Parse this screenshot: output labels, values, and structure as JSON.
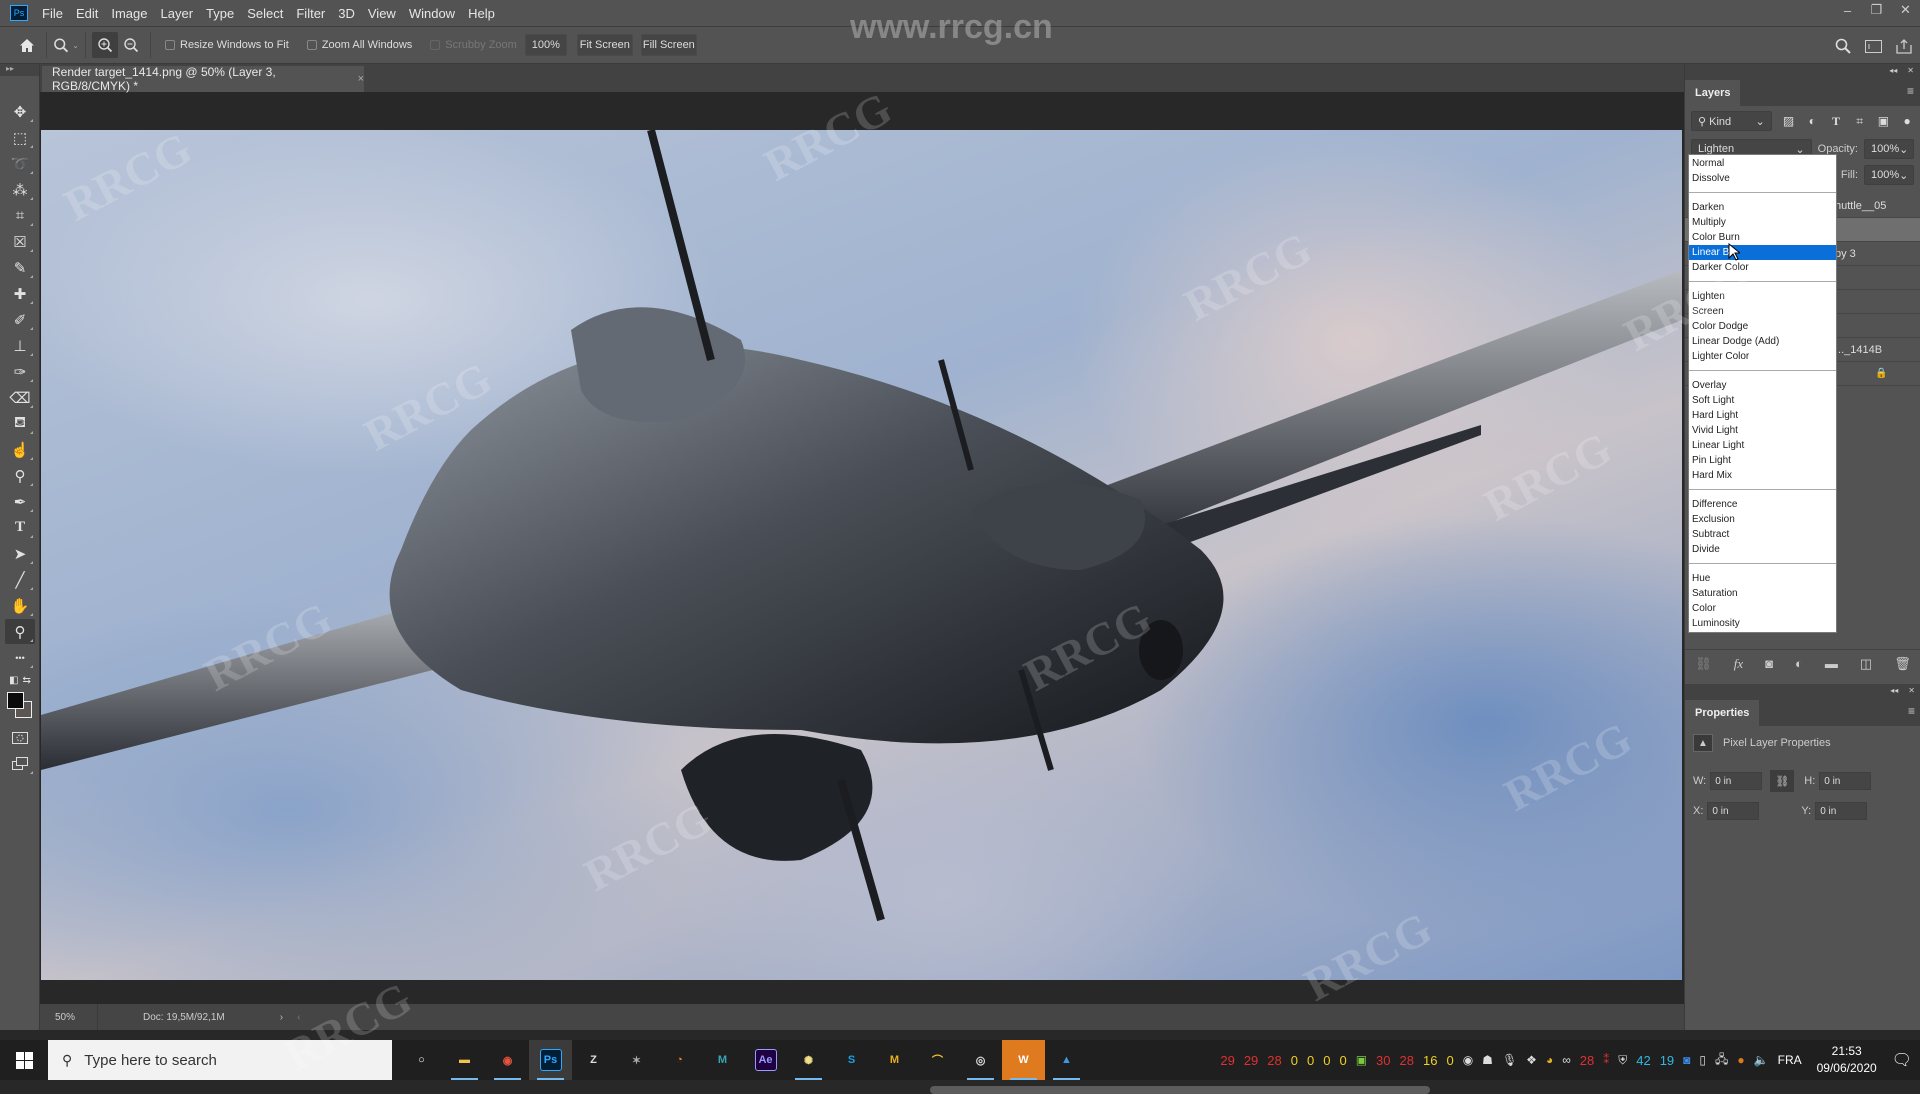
{
  "app": {
    "logo": "Ps",
    "watermark_site": "www.rrcg.cn",
    "watermark_text": "RRCG"
  },
  "menu": [
    "File",
    "Edit",
    "Image",
    "Layer",
    "Type",
    "Select",
    "Filter",
    "3D",
    "View",
    "Window",
    "Help"
  ],
  "window_controls": {
    "minimize": "–",
    "restore": "❐",
    "close": "✕"
  },
  "options_bar": {
    "resize_windows_label": "Resize Windows to Fit",
    "resize_windows_checked": false,
    "zoom_all_label": "Zoom All Windows",
    "zoom_all_checked": false,
    "scrubby_zoom_label": "Scrubby Zoom",
    "scrubby_zoom_checked": false,
    "zoom_value": "100%",
    "fit_screen_label": "Fit Screen",
    "fill_screen_label": "Fill Screen"
  },
  "tools": [
    "move",
    "rectangular-marquee",
    "lasso",
    "magic-wand",
    "crop",
    "frame",
    "eyedropper",
    "healing-brush",
    "brush",
    "clone-stamp",
    "history-brush",
    "eraser",
    "paint-bucket",
    "smudge",
    "dodge",
    "pen",
    "type",
    "path-selection",
    "line",
    "hand",
    "zoom",
    "more-tools"
  ],
  "document": {
    "tab_title": "Render target_1414.png @ 50% (Layer 3, RGB/8/CMYK) *",
    "close_label": "×",
    "status_zoom": "50%",
    "status_doc": "Doc: 19,5M/92,1M"
  },
  "layers_panel": {
    "title": "Layers",
    "filter_kind": "Kind",
    "blend_mode": "Lighten",
    "opacity_label": "Opacity:",
    "opacity_value": "100%",
    "fill_label": "Fill:",
    "fill_value": "100%",
    "layers": [
      {
        "name": "huttle__05",
        "selected": false
      },
      {
        "name": "",
        "selected": true
      },
      {
        "name": "py 3",
        "selected": false
      },
      {
        "name": "",
        "selected": false
      },
      {
        "name": "",
        "selected": false
      },
      {
        "name": "",
        "selected": false
      },
      {
        "name": "..._1414B",
        "selected": false
      },
      {
        "name": "",
        "selected": false,
        "locked": true
      }
    ]
  },
  "blend_dropdown": {
    "highlighted": "Linear Burn",
    "highlighted_visible_text": "Linear Bu",
    "groups": [
      [
        "Normal",
        "Dissolve"
      ],
      [
        "Darken",
        "Multiply",
        "Color Burn",
        "Linear Burn",
        "Darker Color"
      ],
      [
        "Lighten",
        "Screen",
        "Color Dodge",
        "Linear Dodge (Add)",
        "Lighter Color"
      ],
      [
        "Overlay",
        "Soft Light",
        "Hard Light",
        "Vivid Light",
        "Linear Light",
        "Pin Light",
        "Hard Mix"
      ],
      [
        "Difference",
        "Exclusion",
        "Subtract",
        "Divide"
      ],
      [
        "Hue",
        "Saturation",
        "Color",
        "Luminosity"
      ]
    ]
  },
  "properties_panel": {
    "title": "Properties",
    "subtitle": "Pixel Layer Properties",
    "w_label": "W:",
    "w_value": "0 in",
    "h_label": "H:",
    "h_value": "0 in",
    "x_label": "X:",
    "x_value": "0 in",
    "y_label": "Y:",
    "y_value": "0 in"
  },
  "taskbar": {
    "search_placeholder": "Type here to search",
    "apps": [
      {
        "name": "cortana",
        "glyph": "○",
        "color": "#ffffff",
        "running": false
      },
      {
        "name": "file-explorer",
        "glyph": "▬",
        "color": "#f2c14e",
        "running": true
      },
      {
        "name": "chrome",
        "glyph": "◉",
        "color": "#e5533d",
        "running": true
      },
      {
        "name": "photoshop",
        "glyph": "Ps",
        "color": "#31a8ff",
        "running": true,
        "active": true
      },
      {
        "name": "zbrush",
        "glyph": "Z",
        "color": "#dddddd",
        "running": false
      },
      {
        "name": "substance",
        "glyph": "✶",
        "color": "#aaaaaa",
        "running": false
      },
      {
        "name": "blender",
        "glyph": "◔",
        "color": "#f08a24",
        "running": false
      },
      {
        "name": "maya",
        "glyph": "M",
        "color": "#37a5b5",
        "running": false
      },
      {
        "name": "after-effects",
        "glyph": "Ae",
        "color": "#9999ff",
        "running": false
      },
      {
        "name": "lightbulb-app",
        "glyph": "✺",
        "color": "#f0e08a",
        "running": true
      },
      {
        "name": "skype",
        "glyph": "S",
        "color": "#1aa0e8",
        "running": false
      },
      {
        "name": "marmoset",
        "glyph": "M",
        "color": "#e8b020",
        "running": false
      },
      {
        "name": "arch-app",
        "glyph": "⌒",
        "color": "#f0c030",
        "running": false
      },
      {
        "name": "obs",
        "glyph": "◎",
        "color": "#dddddd",
        "running": true
      },
      {
        "name": "wacom-app",
        "glyph": "W",
        "color": "#ffffff",
        "running": true,
        "highlight": "#e07a1f"
      },
      {
        "name": "photos",
        "glyph": "▲",
        "color": "#3a9ae8",
        "running": true
      }
    ],
    "tray_numbers": [
      {
        "v": "29",
        "c": "#e03030"
      },
      {
        "v": "29",
        "c": "#e03030"
      },
      {
        "v": "28",
        "c": "#e03030"
      },
      {
        "v": "0",
        "c": "#f0d020"
      },
      {
        "v": "0",
        "c": "#f0d020"
      },
      {
        "v": "0",
        "c": "#f0d020"
      },
      {
        "v": "0",
        "c": "#f0d020"
      }
    ],
    "tray_numbers_2": [
      {
        "v": "30",
        "c": "#e03030"
      },
      {
        "v": "28",
        "c": "#e03030"
      },
      {
        "v": "16",
        "c": "#f0d020"
      },
      {
        "v": "0",
        "c": "#f0d020"
      }
    ],
    "tray_numbers_3": [
      {
        "v": "28",
        "c": "#e03030"
      }
    ],
    "tray_numbers_4": [
      {
        "v": "42",
        "c": "#30b8e0"
      },
      {
        "v": "19",
        "c": "#30b8e0"
      }
    ],
    "language": "FRA",
    "time": "21:53",
    "date": "09/06/2020"
  }
}
